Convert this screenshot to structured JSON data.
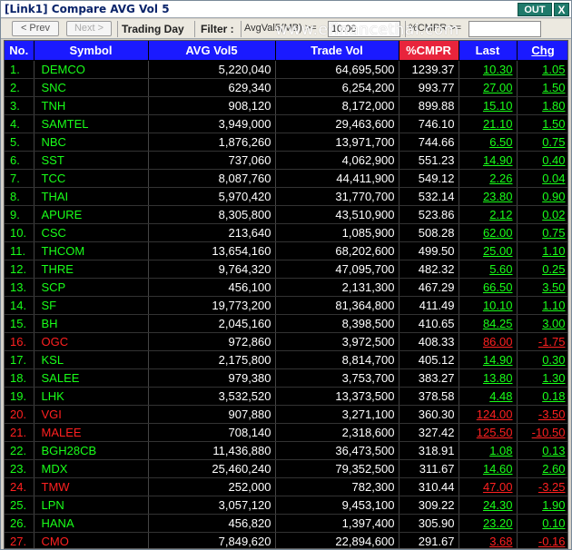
{
  "window": {
    "title": "[Link1] Compare AVG Vol 5",
    "out_label": "OUT",
    "close_label": "X"
  },
  "toolbar": {
    "prev_label": "< Prev",
    "next_label": "Next >",
    "mode_label": "Trading Day",
    "filter_label": "Filter :",
    "avg_label": "AvgVal5(MB) >=",
    "avg_value": "10.00",
    "cmpr_label": "%CMPR >=",
    "cmpr_value": ""
  },
  "watermark": "www.efinancethai.com",
  "table": {
    "columns": [
      "No.",
      "Symbol",
      "AVG Vol5",
      "Trade Vol",
      "%CMPR",
      "Last",
      "Chg"
    ],
    "rows": [
      {
        "no": "1.",
        "symbol": "DEMCO",
        "avg": "5,220,040",
        "vol": "64,695,500",
        "cmpr": "1239.37",
        "last": "10.30",
        "chg": "1.05",
        "dir": "up"
      },
      {
        "no": "2.",
        "symbol": "SNC",
        "avg": "629,340",
        "vol": "6,254,200",
        "cmpr": "993.77",
        "last": "27.00",
        "chg": "1.50",
        "dir": "up"
      },
      {
        "no": "3.",
        "symbol": "TNH",
        "avg": "908,120",
        "vol": "8,172,000",
        "cmpr": "899.88",
        "last": "15.10",
        "chg": "1.80",
        "dir": "up"
      },
      {
        "no": "4.",
        "symbol": "SAMTEL",
        "avg": "3,949,000",
        "vol": "29,463,600",
        "cmpr": "746.10",
        "last": "21.10",
        "chg": "1.50",
        "dir": "up"
      },
      {
        "no": "5.",
        "symbol": "NBC",
        "avg": "1,876,260",
        "vol": "13,971,700",
        "cmpr": "744.66",
        "last": "6.50",
        "chg": "0.75",
        "dir": "up"
      },
      {
        "no": "6.",
        "symbol": "SST",
        "avg": "737,060",
        "vol": "4,062,900",
        "cmpr": "551.23",
        "last": "14.90",
        "chg": "0.40",
        "dir": "up"
      },
      {
        "no": "7.",
        "symbol": "TCC",
        "avg": "8,087,760",
        "vol": "44,411,900",
        "cmpr": "549.12",
        "last": "2.26",
        "chg": "0.04",
        "dir": "up"
      },
      {
        "no": "8.",
        "symbol": "THAI",
        "avg": "5,970,420",
        "vol": "31,770,700",
        "cmpr": "532.14",
        "last": "23.80",
        "chg": "0.90",
        "dir": "up"
      },
      {
        "no": "9.",
        "symbol": "APURE",
        "avg": "8,305,800",
        "vol": "43,510,900",
        "cmpr": "523.86",
        "last": "2.12",
        "chg": "0.02",
        "dir": "up"
      },
      {
        "no": "10.",
        "symbol": "CSC",
        "avg": "213,640",
        "vol": "1,085,900",
        "cmpr": "508.28",
        "last": "62.00",
        "chg": "0.75",
        "dir": "up"
      },
      {
        "no": "11.",
        "symbol": "THCOM",
        "avg": "13,654,160",
        "vol": "68,202,600",
        "cmpr": "499.50",
        "last": "25.00",
        "chg": "1.10",
        "dir": "up"
      },
      {
        "no": "12.",
        "symbol": "THRE",
        "avg": "9,764,320",
        "vol": "47,095,700",
        "cmpr": "482.32",
        "last": "5.60",
        "chg": "0.25",
        "dir": "up"
      },
      {
        "no": "13.",
        "symbol": "SCP",
        "avg": "456,100",
        "vol": "2,131,300",
        "cmpr": "467.29",
        "last": "66.50",
        "chg": "3.50",
        "dir": "up"
      },
      {
        "no": "14.",
        "symbol": "SF",
        "avg": "19,773,200",
        "vol": "81,364,800",
        "cmpr": "411.49",
        "last": "10.10",
        "chg": "1.10",
        "dir": "up"
      },
      {
        "no": "15.",
        "symbol": "BH",
        "avg": "2,045,160",
        "vol": "8,398,500",
        "cmpr": "410.65",
        "last": "84.25",
        "chg": "3.00",
        "dir": "up"
      },
      {
        "no": "16.",
        "symbol": "OGC",
        "avg": "972,860",
        "vol": "3,972,500",
        "cmpr": "408.33",
        "last": "86.00",
        "chg": "-1.75",
        "dir": "dn"
      },
      {
        "no": "17.",
        "symbol": "KSL",
        "avg": "2,175,800",
        "vol": "8,814,700",
        "cmpr": "405.12",
        "last": "14.90",
        "chg": "0.30",
        "dir": "up"
      },
      {
        "no": "18.",
        "symbol": "SALEE",
        "avg": "979,380",
        "vol": "3,753,700",
        "cmpr": "383.27",
        "last": "13.80",
        "chg": "1.30",
        "dir": "up"
      },
      {
        "no": "19.",
        "symbol": "LHK",
        "avg": "3,532,520",
        "vol": "13,373,500",
        "cmpr": "378.58",
        "last": "4.48",
        "chg": "0.18",
        "dir": "up"
      },
      {
        "no": "20.",
        "symbol": "VGI",
        "avg": "907,880",
        "vol": "3,271,100",
        "cmpr": "360.30",
        "last": "124.00",
        "chg": "-3.50",
        "dir": "dn"
      },
      {
        "no": "21.",
        "symbol": "MALEE",
        "avg": "708,140",
        "vol": "2,318,600",
        "cmpr": "327.42",
        "last": "125.50",
        "chg": "-10.50",
        "dir": "dn"
      },
      {
        "no": "22.",
        "symbol": "BGH28CB",
        "avg": "11,436,880",
        "vol": "36,473,500",
        "cmpr": "318.91",
        "last": "1.08",
        "chg": "0.13",
        "dir": "up"
      },
      {
        "no": "23.",
        "symbol": "MDX",
        "avg": "25,460,240",
        "vol": "79,352,500",
        "cmpr": "311.67",
        "last": "14.60",
        "chg": "2.60",
        "dir": "up"
      },
      {
        "no": "24.",
        "symbol": "TMW",
        "avg": "252,000",
        "vol": "782,300",
        "cmpr": "310.44",
        "last": "47.00",
        "chg": "-3.25",
        "dir": "dn"
      },
      {
        "no": "25.",
        "symbol": "LPN",
        "avg": "3,057,120",
        "vol": "9,453,100",
        "cmpr": "309.22",
        "last": "24.30",
        "chg": "1.90",
        "dir": "up"
      },
      {
        "no": "26.",
        "symbol": "HANA",
        "avg": "456,820",
        "vol": "1,397,400",
        "cmpr": "305.90",
        "last": "23.20",
        "chg": "0.10",
        "dir": "up"
      },
      {
        "no": "27.",
        "symbol": "CMO",
        "avg": "7,849,620",
        "vol": "22,894,600",
        "cmpr": "291.67",
        "last": "3.68",
        "chg": "-0.16",
        "dir": "dn"
      }
    ]
  }
}
